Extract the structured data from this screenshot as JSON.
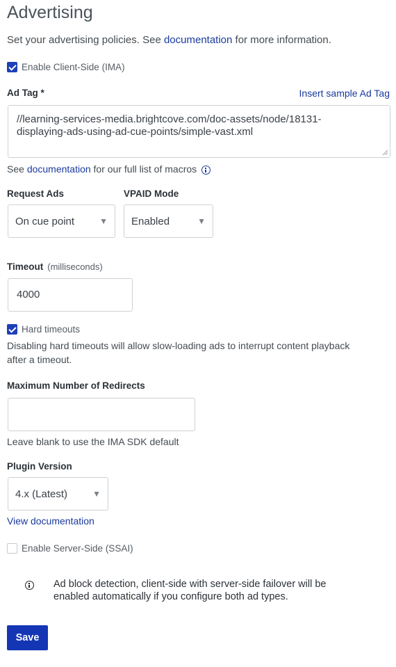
{
  "heading": "Advertising",
  "intro": {
    "before": "Set your advertising policies. See ",
    "link": "documentation",
    "after": " for more information."
  },
  "client_side": {
    "label": "Enable Client-Side (IMA)",
    "checked": true
  },
  "ad_tag": {
    "label": "Ad Tag *",
    "sample_link": "Insert sample Ad Tag",
    "line1": "//learning-services-media.brightcove.com/doc-assets/node/18131-",
    "line2": "displaying-ads-using-ad-cue-points/simple-vast.xml"
  },
  "macros": {
    "before": "See ",
    "link": "documentation",
    "after": " for our full list of macros",
    "icon": "info-icon"
  },
  "request_ads": {
    "label": "Request Ads",
    "value": "On cue point"
  },
  "vpaid": {
    "label": "VPAID Mode",
    "value": "Enabled"
  },
  "timeout": {
    "label": "Timeout",
    "unit": "(milliseconds)",
    "value": "4000"
  },
  "hard_timeouts": {
    "label": "Hard timeouts",
    "checked": true,
    "help1": "Disabling hard timeouts will allow slow-loading ads to interrupt content playback",
    "help2": "after a timeout."
  },
  "redirects": {
    "label": "Maximum Number of Redirects",
    "value": "",
    "help": "Leave blank to use the IMA SDK default"
  },
  "plugin": {
    "label": "Plugin Version",
    "value": "4.x (Latest)",
    "doc_link": "View documentation"
  },
  "server_side": {
    "label": "Enable Server-Side (SSAI)",
    "checked": false
  },
  "notice": {
    "icon": "info-icon",
    "line1": "Ad block detection, client-side with server-side failover will be",
    "line2": "enabled automatically if you configure both ad types."
  },
  "save_label": "Save",
  "colors": {
    "accent": "#1536b4",
    "link": "#1a3a9e"
  }
}
